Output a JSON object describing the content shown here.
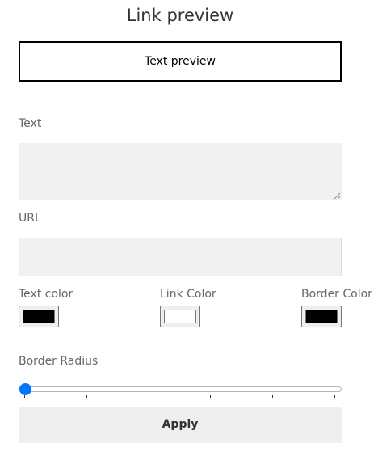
{
  "header": {
    "title": "Link preview"
  },
  "preview": {
    "text": "Text preview",
    "border_color": "#000000"
  },
  "form": {
    "text_label": "Text",
    "text_value": "",
    "url_label": "URL",
    "url_value": ""
  },
  "colors": {
    "text_color_label": "Text color",
    "text_color_value": "#000000",
    "link_color_label": "Link Color",
    "link_color_value": "#ffffff",
    "border_color_label": "Border Color",
    "border_color_value": "#000000"
  },
  "border_radius": {
    "label": "Border Radius",
    "value_fraction": 0
  },
  "actions": {
    "apply_label": "Apply"
  },
  "theme": {
    "slider_accent": "#0075ff",
    "field_background": "#f1f1f1"
  }
}
